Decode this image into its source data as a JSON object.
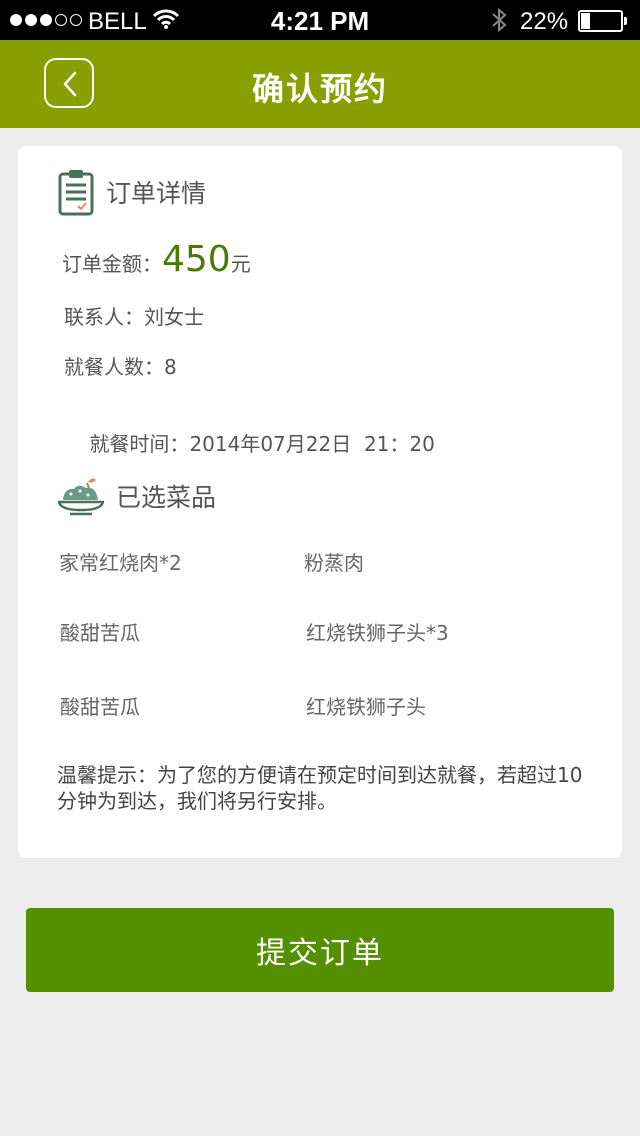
{
  "status_bar": {
    "carrier": "BELL",
    "time": "4:21 PM",
    "battery": "22%",
    "battery_level": 0.22,
    "signal_bars_filled": 3,
    "signal_bars_total": 5
  },
  "nav": {
    "title": "确认预约",
    "back_icon": "chevron-left-icon"
  },
  "order": {
    "header": "订单详情",
    "amount_label": "订单金额：",
    "amount_value": "450",
    "amount_unit": "元",
    "contact_label": "联系人：",
    "contact_value": "刘女士",
    "diners_label": "就餐人数：",
    "diners_value": "8",
    "time_label": "就餐时间：",
    "time_value": "2014年07月22日  21：20"
  },
  "dishes": {
    "header": "已选菜品",
    "items": [
      "家常红烧肉*2",
      "粉蒸肉",
      "酸甜苦瓜",
      "红烧铁狮子头*3",
      "酸甜苦瓜",
      "红烧铁狮子头"
    ]
  },
  "tip": "温馨提示：为了您的方便请在预定时间到达就餐，若超过10分钟为到达，我们将另行安排。",
  "submit_label": "提交订单",
  "colors": {
    "nav_bg": "#87a000",
    "submit_bg": "#548f00",
    "amount": "#4a7a00"
  }
}
